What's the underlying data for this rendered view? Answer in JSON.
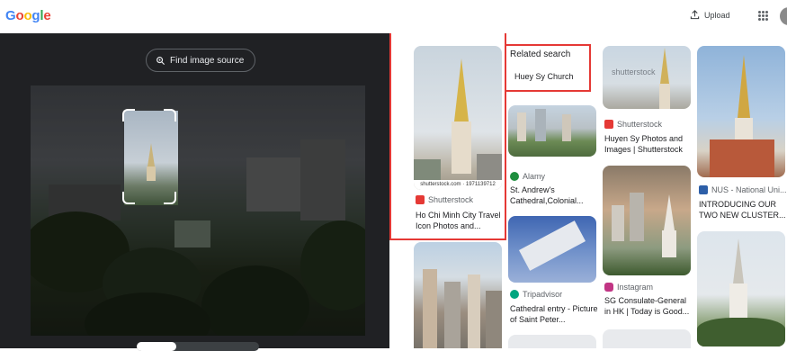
{
  "header": {
    "logo_letters": [
      {
        "ch": "G",
        "color": "#4285F4"
      },
      {
        "ch": "o",
        "color": "#EA4335"
      },
      {
        "ch": "o",
        "color": "#FBBC05"
      },
      {
        "ch": "g",
        "color": "#4285F4"
      },
      {
        "ch": "l",
        "color": "#34A853"
      },
      {
        "ch": "e",
        "color": "#EA4335"
      }
    ],
    "upload_label": "Upload",
    "upload_icon": "upload-icon",
    "apps_icon": "apps-grid-icon"
  },
  "lens": {
    "find_source_label": "Find image source",
    "find_source_icon": "lens-search-icon"
  },
  "results": {
    "col1": [
      {
        "watermark": "shutterstock.com · 1971139712",
        "source": "Shutterstock",
        "source_color": "#e53935",
        "title": "Ho Chi Minh City Travel Icon Photos and..."
      },
      {
        "source": "",
        "title": ""
      }
    ],
    "related": {
      "heading": "Related search",
      "chip": "Huey Sy Church"
    },
    "col2": [
      {
        "source": "Alamy",
        "source_color": "#1e8e3e",
        "title": "St. Andrew's Cathedral,Colonial..."
      },
      {
        "source": "Tripadvisor",
        "source_color": "#00a680",
        "title": "Cathedral entry - Picture of Saint Peter..."
      }
    ],
    "col3": [
      {
        "watermark": "shutterstock",
        "source": "Shutterstock",
        "source_color": "#e53935",
        "title": "Huyen Sy Photos and Images | Shutterstock"
      },
      {
        "source": "Instagram",
        "source_color": "#c13584",
        "title": "SG Consulate-General in HK | Today is Good..."
      }
    ],
    "col4": [
      {
        "source": "NUS - National Uni...",
        "source_color": "#2d5fa8",
        "title": "INTRODUCING OUR TWO NEW CLUSTER..."
      }
    ]
  }
}
